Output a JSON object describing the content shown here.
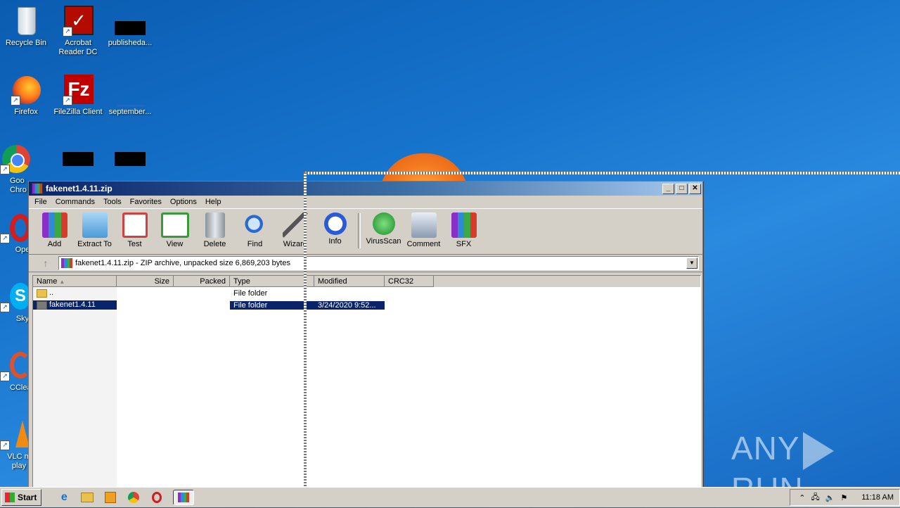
{
  "desktop": {
    "icons": [
      {
        "label": "Recycle Bin"
      },
      {
        "label": "Acrobat Reader DC"
      },
      {
        "label": "publisheda..."
      },
      {
        "label": "Firefox"
      },
      {
        "label": "FileZilla Client"
      },
      {
        "label": "september..."
      },
      {
        "label": "Goo Chro"
      },
      {
        "label": "Ope"
      },
      {
        "label": "Sky"
      },
      {
        "label": "CClea"
      },
      {
        "label": "VLC m play"
      }
    ]
  },
  "window": {
    "title": "fakenet1.4.11.zip",
    "controls": {
      "minimize": "_",
      "maximize": "□",
      "close": "✕"
    },
    "menu": [
      "File",
      "Commands",
      "Tools",
      "Favorites",
      "Options",
      "Help"
    ],
    "toolbar": [
      {
        "label": "Add",
        "icon": "add-icon",
        "color": "#b85cd6"
      },
      {
        "label": "Extract To",
        "icon": "extract-folder-icon",
        "color": "#6ab3e8"
      },
      {
        "label": "Test",
        "icon": "test-clipboard-icon",
        "color": "#e05050"
      },
      {
        "label": "View",
        "icon": "view-book-icon",
        "color": "#3a9a3a"
      },
      {
        "label": "Delete",
        "icon": "trash-icon",
        "color": "#9aa0a6"
      },
      {
        "label": "Find",
        "icon": "magnifier-icon",
        "color": "#2a6ad0"
      },
      {
        "label": "Wizarc",
        "icon": "wizard-wand-icon",
        "color": "#4cb04c"
      },
      {
        "label": "Info",
        "icon": "info-icon",
        "color": "#2a5ad8"
      },
      {
        "label": "VirusScan",
        "icon": "virus-scan-icon",
        "color": "#2aa040"
      },
      {
        "label": "Comment",
        "icon": "comment-icon",
        "color": "#8a9ab0"
      },
      {
        "label": "SFX",
        "icon": "sfx-books-icon",
        "color": "#d06030"
      }
    ],
    "address": "fakenet1.4.11.zip - ZIP archive, unpacked size 6,869,203 bytes",
    "columns": [
      "Name",
      "Size",
      "Packed",
      "Type",
      "Modified",
      "CRC32"
    ],
    "rows": [
      {
        "name": "..",
        "size": "",
        "packed": "",
        "type": "File folder",
        "modified": "",
        "crc": ""
      },
      {
        "name": "fakenet1.4.11",
        "size": "",
        "packed": "",
        "type": "File folder",
        "modified": "3/24/2020 9:52...",
        "crc": ""
      }
    ]
  },
  "watermark": {
    "left": "ANY",
    "right": "RUN"
  },
  "taskbar": {
    "start": "Start",
    "quick": [
      "ie-icon",
      "explorer-icon",
      "media-player-icon",
      "chrome-icon",
      "opera-icon",
      "winrar-icon"
    ],
    "clock": "11:18 AM"
  }
}
